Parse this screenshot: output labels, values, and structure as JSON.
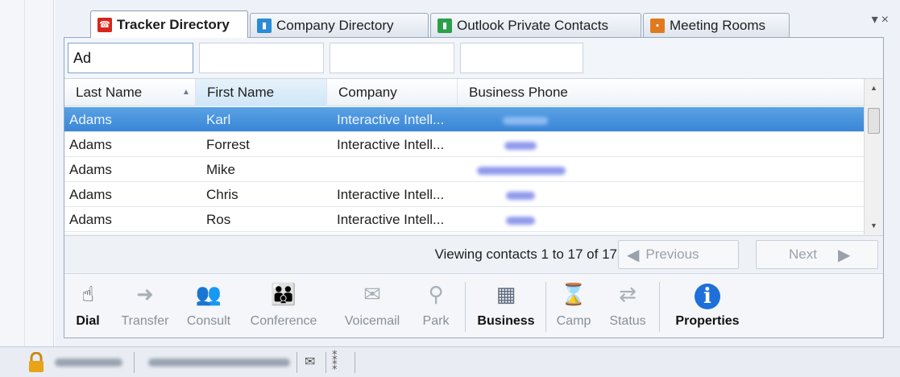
{
  "tabs": [
    {
      "label": "Tracker Directory",
      "icon": "tracker-directory-icon",
      "color": "#d9251c",
      "active": true
    },
    {
      "label": "Company Directory",
      "icon": "company-directory-icon",
      "color": "#2a8bd6",
      "active": false
    },
    {
      "label": "Outlook Private Contacts",
      "icon": "outlook-contacts-icon",
      "color": "#2aa048",
      "active": false
    },
    {
      "label": "Meeting Rooms",
      "icon": "meeting-rooms-icon",
      "color": "#e07a1e",
      "active": false
    }
  ],
  "pane_controls": {
    "pin": "▾",
    "close": "×"
  },
  "filters": {
    "last_name": "Ad",
    "first_name": "",
    "company": "",
    "business_phone": ""
  },
  "grid": {
    "columns": [
      "Last Name",
      "First Name",
      "Company",
      "Business Phone"
    ],
    "sort_column": "First Name",
    "rows": [
      {
        "last": "Adams",
        "first": "Karl",
        "company": "Interactive Intell...",
        "phone": "(blurred)",
        "selected": true
      },
      {
        "last": "Adams",
        "first": "Forrest",
        "company": "Interactive Intell...",
        "phone": "(blurred)",
        "selected": false
      },
      {
        "last": "Adams",
        "first": "Mike",
        "company": "",
        "phone": "(blurred)",
        "selected": false
      },
      {
        "last": "Adams",
        "first": "Chris",
        "company": "Interactive Intell...",
        "phone": "(blurred)",
        "selected": false
      },
      {
        "last": "Adams",
        "first": "Ros",
        "company": "Interactive Intell...",
        "phone": "(blurred)",
        "selected": false
      }
    ]
  },
  "paging": {
    "viewing": "Viewing contacts 1 to 17 of 17",
    "previous": "Previous",
    "next": "Next"
  },
  "toolbar": {
    "dial": "Dial",
    "transfer": "Transfer",
    "consult": "Consult",
    "conference": "Conference",
    "voicemail": "Voicemail",
    "park": "Park",
    "business": "Business",
    "camp": "Camp",
    "status": "Status",
    "properties": "Properties"
  },
  "colors": {
    "selection": "#3a86d6",
    "info": "#1e6fd9",
    "lock": "#e8a317"
  }
}
